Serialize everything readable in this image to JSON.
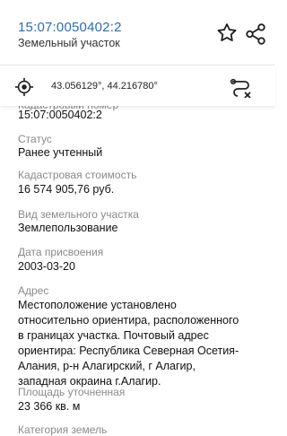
{
  "header": {
    "title": "15:07:0050402:2",
    "subtitle": "Земельный участок",
    "star_icon": "star-outline-icon",
    "share_icon": "share-icon"
  },
  "coords": {
    "text": "43.056129°, 44.216780°",
    "locate_icon": "crosshair-icon",
    "route_icon": "route-icon"
  },
  "fields": {
    "cadastral_label": "Кадастровый номер",
    "cadastral_value": "15:07:0050402:2",
    "status_label": "Статус",
    "status_value": "Ранее учтенный",
    "cost_label": "Кадастровая стоимость",
    "cost_value": "16 574 905,76 руб.",
    "use_label": "Вид земельного участка",
    "use_value": "Землепользование",
    "date_label": "Дата присвоения",
    "date_value": "2003-03-20",
    "address_label": "Адрес",
    "address_lines": [
      "Местоположение установлено",
      "относительно ориентира, расположенного",
      "в границах участка. Почтовый адрес",
      "ориентира: Республика Северная Осетия-",
      "Алания, р-н Алагирский, г Алагир,",
      "западная окраина г.Алагир."
    ],
    "area_label": "Площадь уточненная",
    "area_value": "23 366 кв. м",
    "category_label": "Категория земель"
  },
  "colors": {
    "title": "#2e6db4",
    "label": "#8a8a8a",
    "value": "#111111"
  }
}
